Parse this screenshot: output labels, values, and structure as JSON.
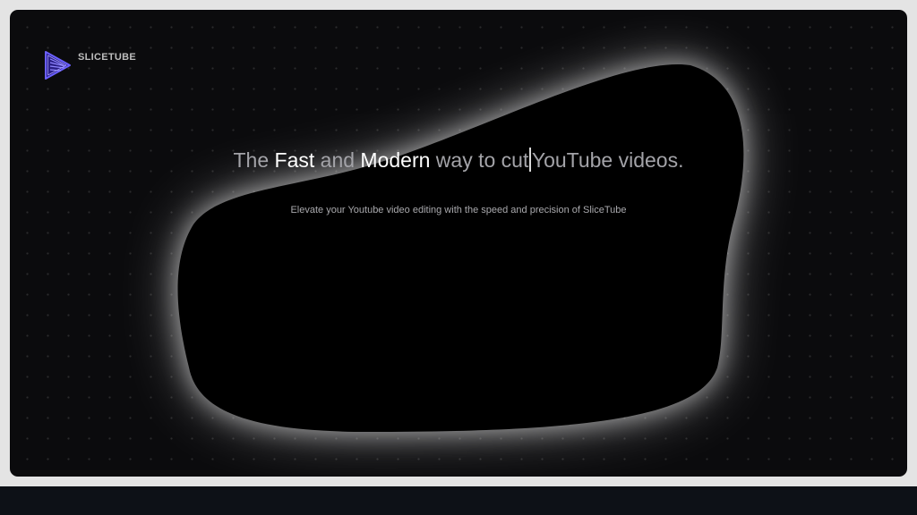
{
  "brand": {
    "name": "SLICETUBE",
    "logo_icon": "play-icon",
    "logo_color": "#5b4ff5"
  },
  "hero": {
    "headline": {
      "w1": "The",
      "w2": "Fast",
      "w3": "and",
      "w4": "Modern",
      "w5": "way to cut",
      "w6": "YouTube videos."
    },
    "subtitle": "Elevate your Youtube video editing with the speed and precision of SliceTube"
  },
  "colors": {
    "card_background": "#0b0b0d",
    "blob_fill": "#000000",
    "blob_glow": "#ffffff",
    "bottom_bar": "#0d1117"
  }
}
